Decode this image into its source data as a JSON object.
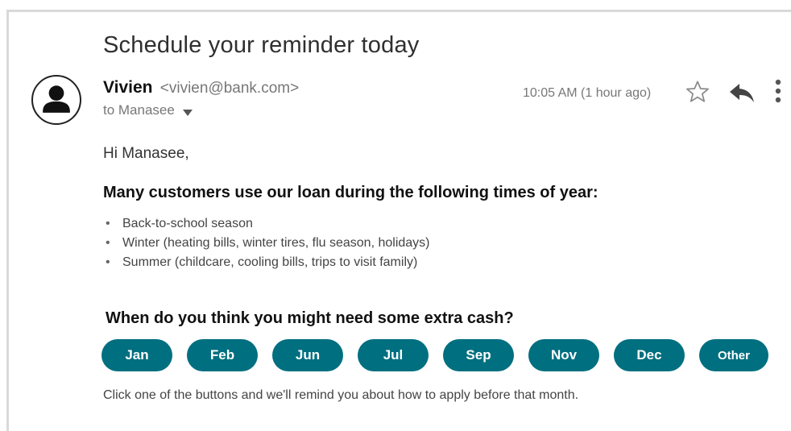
{
  "email": {
    "subject": "Schedule your reminder today",
    "sender": {
      "name": "Vivien",
      "email": "<vivien@bank.com>"
    },
    "recipient": "to Manasee",
    "timestamp": "10:05 AM (1 hour ago)",
    "icons": {
      "avatar": "person-icon",
      "star": "star-icon",
      "reply": "reply-icon",
      "more": "more-vert-icon"
    }
  },
  "body": {
    "greeting": "Hi Manasee,",
    "heading": "Many customers use our loan during the following times of year:",
    "bullets": [
      "Back-to-school season",
      "Winter (heating bills, winter tires, flu season, holidays)",
      "Summer (childcare, cooling bills, trips to visit family)"
    ],
    "question": "When do you think you might need some extra cash?",
    "months": [
      "Jan",
      "Feb",
      "Jun",
      "Jul",
      "Sep",
      "Nov",
      "Dec",
      "Other"
    ],
    "footer": "Click one of the buttons and we'll remind you about how to apply before that month."
  },
  "colors": {
    "button_bg": "#006f80",
    "button_text": "#ffffff",
    "frame_border": "#d9d9d9"
  }
}
